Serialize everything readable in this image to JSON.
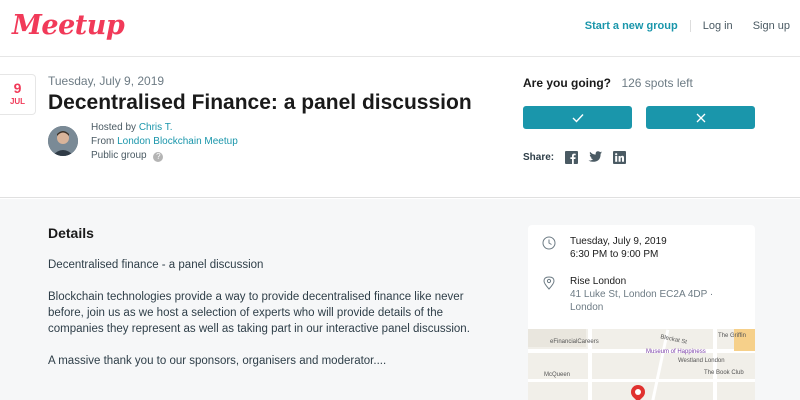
{
  "nav": {
    "logo": "Meetup",
    "start_group": "Start a new group",
    "login": "Log in",
    "signup": "Sign up"
  },
  "event": {
    "date_day": "9",
    "date_month": "JUL",
    "date_full": "Tuesday, July 9, 2019",
    "title": "Decentralised Finance: a panel discussion",
    "hosted_by_prefix": "Hosted by",
    "host_name": "Chris T.",
    "from_prefix": "From",
    "group_name": "London Blockchain Meetup",
    "group_type": "Public group",
    "info_glyph": "?"
  },
  "rsvp": {
    "question": "Are you going?",
    "spots": "126 spots left",
    "yes_icon": "check-icon",
    "no_icon": "x-icon"
  },
  "share": {
    "label": "Share:",
    "icons": [
      "facebook-icon",
      "twitter-icon",
      "linkedin-icon"
    ]
  },
  "details": {
    "heading": "Details",
    "paragraphs": [
      "Decentralised finance - a panel discussion",
      "Blockchain technologies provide a way to provide decentralised finance like never before, join us as we host a selection of experts who will provide details of the companies they represent as well as taking part in our interactive panel discussion.",
      "A massive thank you to our sponsors, organisers and moderator...."
    ]
  },
  "sidebar": {
    "date": "Tuesday, July 9, 2019",
    "time": "6:30 PM to 9:00 PM",
    "venue": "Rise London",
    "address": "41 Luke St, London EC2A 4DP ·",
    "city": "London"
  },
  "map": {
    "labels": [
      "eFinancialCareers",
      "Museum of Happiness",
      "Westland London",
      "The Book Club",
      "McQueen",
      "Bleckat St",
      "The Griffin"
    ]
  },
  "colors": {
    "brand": "#f13a59",
    "accent": "#1a96ab"
  }
}
